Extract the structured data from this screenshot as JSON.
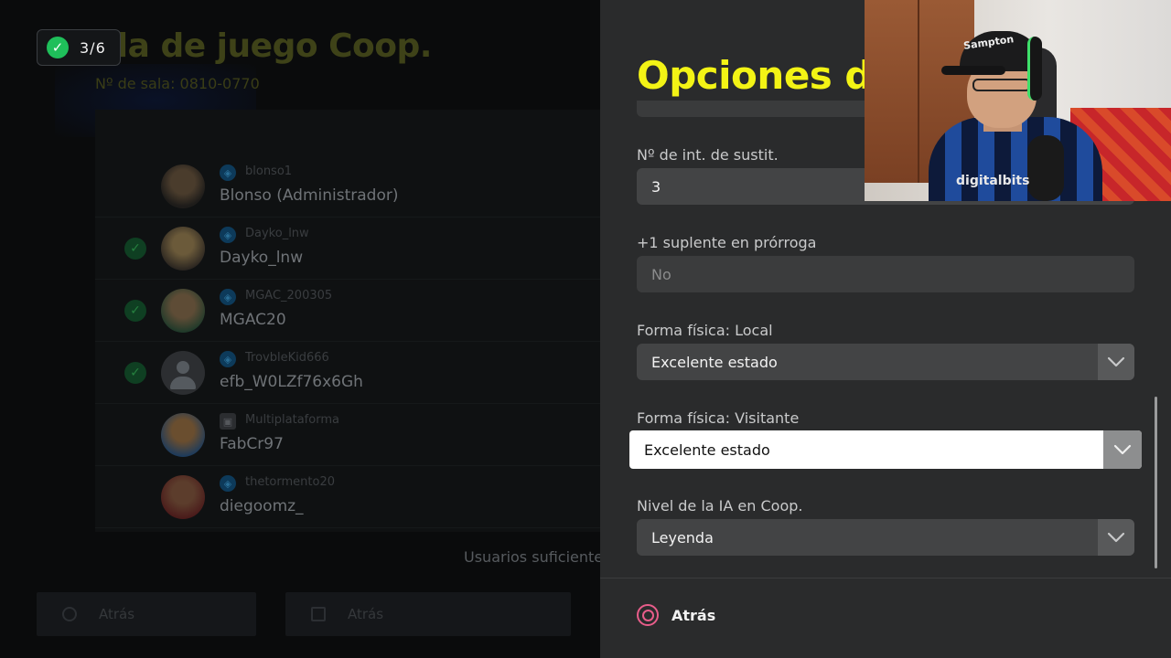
{
  "lobby": {
    "title": "ala de juego Coop.",
    "room_number": "Nº de sala: 0810-0770",
    "ready_counter": "3/6",
    "players": [
      {
        "handle": "blonso1",
        "name": "Blonso (Administrador)",
        "ready": false,
        "platform_icon": "playstation-icon"
      },
      {
        "handle": "Dayko_lnw",
        "name": "Dayko_lnw",
        "ready": true,
        "platform_icon": "playstation-icon"
      },
      {
        "handle": "MGAC_200305",
        "name": "MGAC20",
        "ready": true,
        "platform_icon": "playstation-icon"
      },
      {
        "handle": "TrovbleKid666",
        "name": "efb_W0LZf76x6Gh",
        "ready": true,
        "platform_icon": "playstation-icon"
      },
      {
        "handle": "Multiplataforma",
        "name": "FabCr97",
        "ready": false,
        "platform_icon": "gamepad-icon"
      },
      {
        "handle": "thetormento20",
        "name": "diegoomz_",
        "ready": false,
        "platform_icon": "playstation-icon"
      }
    ],
    "status_text": "Usuarios suficientes",
    "back_label": "Atrás",
    "second_button_label": "Atrás"
  },
  "panel": {
    "title": "Opciones de",
    "options": [
      {
        "label": "Nº de int. de sustit.",
        "value": "3",
        "type": "field"
      },
      {
        "label": "+1 suplente en prórroga",
        "value": "No",
        "type": "disabled"
      },
      {
        "label": "Forma física: Local",
        "value": "Excelente estado",
        "type": "dropdown"
      },
      {
        "label": "Forma física: Visitante",
        "value": "Excelente estado",
        "type": "dropdown-focused"
      },
      {
        "label": "Nivel de la IA en Coop.",
        "value": "Leyenda",
        "type": "dropdown"
      }
    ],
    "back_label": "Atrás"
  },
  "webcam": {
    "cap_text": "Sampton",
    "jersey_text": "digitalbits"
  },
  "colors": {
    "accent_yellow": "#f3f315",
    "ready_green": "#1fbf5a",
    "back_circle": "#e85d8a",
    "panel_bg": "#2a2b2c"
  }
}
